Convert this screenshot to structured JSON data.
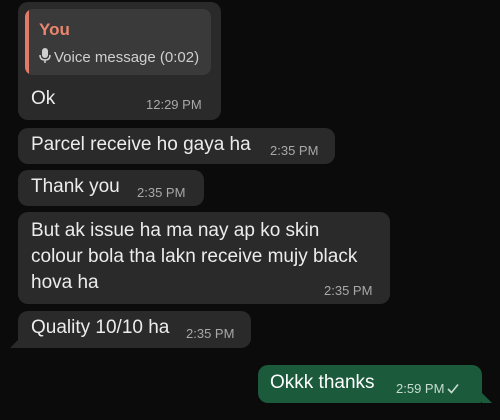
{
  "chat": {
    "reply_message": {
      "quote_sender": "You",
      "quote_text": "Voice message (0:02)",
      "quote_icon": "mic-icon",
      "text": "Ok",
      "time": "12:29 PM"
    },
    "incoming": [
      {
        "text": "Parcel receive ho gaya ha",
        "time": "2:35 PM"
      },
      {
        "text": "Thank you",
        "time": "2:35 PM"
      },
      {
        "text": "But ak issue ha ma nay ap ko skin\ncolour bola tha lakn receive mujy black\nhova ha",
        "time": "2:35 PM"
      },
      {
        "text": "Quality 10/10 ha",
        "time": "2:35 PM"
      }
    ],
    "outgoing": [
      {
        "text": "Okkk thanks",
        "time": "2:59 PM",
        "status_icon": "check-icon"
      }
    ]
  },
  "colors": {
    "background": "#0b0b0b",
    "incoming_bubble": "#2a2a2a",
    "outgoing_bubble": "#1c5a3c",
    "quote_accent": "#e07b6a"
  }
}
